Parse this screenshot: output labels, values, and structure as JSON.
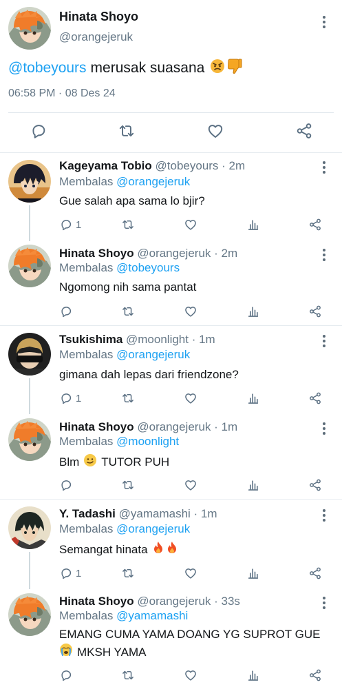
{
  "main_tweet": {
    "name": "Hinata Shoyo",
    "handle": "@orangejeruk",
    "mention": "@tobeyours",
    "text": "merusak suasana",
    "timestamp": "06:58 PM · 08 Des 24",
    "emojis": [
      "angry-face-emoji",
      "thumbs-down-emoji"
    ]
  },
  "replies": [
    {
      "name": "Kageyama Tobio",
      "handle": "@tobeyours",
      "time": "· 2m",
      "replying_to_prefix": "Membalas",
      "replying_to": "@orangejeruk",
      "text": "Gue salah apa sama lo bjir?",
      "reply_count": "1",
      "avatar": "kageyama-avatar"
    },
    {
      "name": "Hinata Shoyo",
      "handle": "@orangejeruk",
      "time": "· 2m",
      "replying_to_prefix": "Membalas",
      "replying_to": "@tobeyours",
      "text": "Ngomong nih sama pantat",
      "reply_count": "",
      "avatar": "hinata-avatar"
    },
    {
      "name": "Tsukishima",
      "handle": "@moonlight",
      "time": "· 1m",
      "replying_to_prefix": "Membalas",
      "replying_to": "@orangejeruk",
      "text": "gimana dah lepas dari friendzone?",
      "reply_count": "1",
      "avatar": "tsukishima-avatar"
    },
    {
      "name": "Hinata Shoyo",
      "handle": "@orangejeruk",
      "time": "· 1m",
      "replying_to_prefix": "Membalas",
      "replying_to": "@moonlight",
      "text_before": "Blm",
      "text_after": "TUTOR PUH",
      "reply_count": "",
      "avatar": "hinata-avatar"
    },
    {
      "name": "Y. Tadashi",
      "handle": "@yamamashi",
      "time": "· 1m",
      "replying_to_prefix": "Membalas",
      "replying_to": "@orangejeruk",
      "text": "Semangat hinata",
      "reply_count": "1",
      "avatar": "yamaguchi-avatar"
    },
    {
      "name": "Hinata Shoyo",
      "handle": "@orangejeruk",
      "time": "· 33s",
      "replying_to_prefix": "Membalas",
      "replying_to": "@yamamashi",
      "text_line1": "EMANG CUMA YAMA DOANG YG SUPROT GUE",
      "text_line2": "MKSH YAMA",
      "reply_count": "",
      "avatar": "hinata-avatar"
    }
  ],
  "colors": {
    "link": "#1da1f2",
    "muted": "#657786",
    "icon": "#5b7083",
    "text": "#14171a"
  },
  "icons": [
    "reply-icon",
    "retweet-icon",
    "like-icon",
    "views-icon",
    "share-icon",
    "more-options-icon"
  ]
}
